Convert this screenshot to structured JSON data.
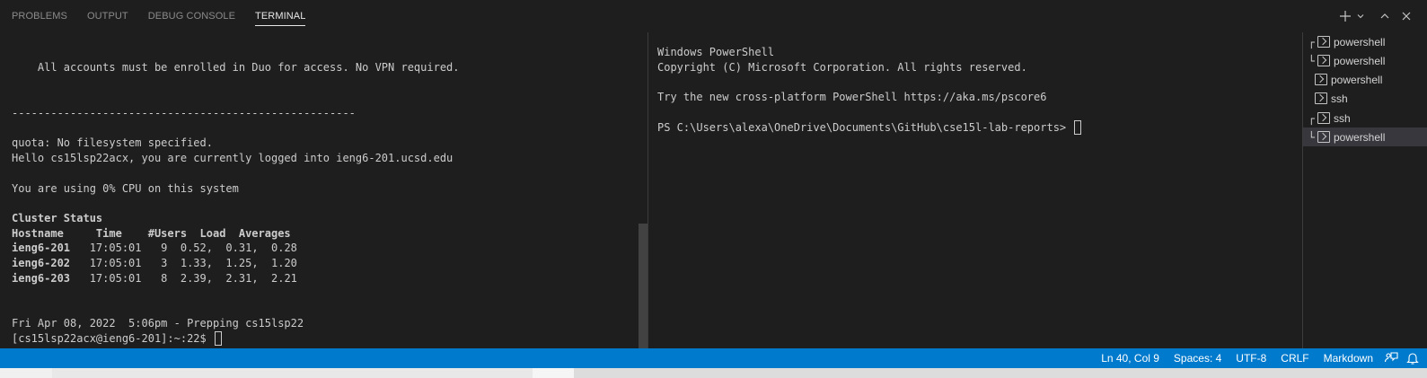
{
  "panel": {
    "tabs": [
      {
        "label": "PROBLEMS"
      },
      {
        "label": "OUTPUT"
      },
      {
        "label": "DEBUG CONSOLE"
      },
      {
        "label": "TERMINAL"
      }
    ],
    "actions": [
      "plus-icon",
      "chevron-down-icon",
      "chevron-up-icon",
      "close-icon"
    ]
  },
  "terminal_left": {
    "duo": "    All accounts must be enrolled in Duo for access. No VPN required.",
    "rule": "-----------------------------------------------------",
    "quota": "quota: No filesystem specified.",
    "hello": "Hello cs15lsp22acx, you are currently logged into ieng6-201.ucsd.edu",
    "cpu": "You are using 0% CPU on this system",
    "cluster_title": "Cluster Status",
    "cluster_header": "Hostname     Time    #Users  Load  Averages",
    "rows": [
      {
        "host": "ieng6-201",
        "rest": "   17:05:01   9  0.52,  0.31,  0.28"
      },
      {
        "host": "ieng6-202",
        "rest": "   17:05:01   3  1.33,  1.25,  1.20"
      },
      {
        "host": "ieng6-203",
        "rest": "   17:05:01   8  2.39,  2.31,  2.21"
      }
    ],
    "date": "Fri Apr 08, 2022  5:06pm - Prepping cs15lsp22",
    "prompt": "[cs15lsp22acx@ieng6-201]:~:22$ "
  },
  "terminal_right": {
    "line1": "Windows PowerShell",
    "line2": "Copyright (C) Microsoft Corporation. All rights reserved.",
    "line3": "Try the new cross-platform PowerShell https://aka.ms/pscore6",
    "prompt": "PS C:\\Users\\alexa\\OneDrive\\Documents\\GitHub\\cse15l-lab-reports> "
  },
  "terminal_list": [
    {
      "label": "powershell",
      "tree": "┌",
      "icon": "terminal-prompt-icon",
      "selected": false
    },
    {
      "label": "powershell",
      "tree": "└",
      "icon": "terminal-prompt-icon",
      "selected": false
    },
    {
      "label": "powershell",
      "tree": "",
      "icon": "terminal-prompt-icon",
      "selected": false
    },
    {
      "label": "ssh",
      "tree": "",
      "icon": "terminal-prompt-icon",
      "selected": false
    },
    {
      "label": "ssh",
      "tree": "┌",
      "icon": "terminal-prompt-icon",
      "selected": false
    },
    {
      "label": "powershell",
      "tree": "└",
      "icon": "terminal-prompt-icon",
      "selected": true
    }
  ],
  "statusbar": {
    "position": "Ln 40, Col 9",
    "spaces": "Spaces: 4",
    "encoding": "UTF-8",
    "eol": "CRLF",
    "language": "Markdown",
    "icons": [
      "feedback-icon",
      "bell-icon"
    ]
  },
  "colors": {
    "background": "#1e1e1e",
    "statusbar": "#007acc",
    "text": "#cccccc",
    "selected_item": "#37373d"
  }
}
